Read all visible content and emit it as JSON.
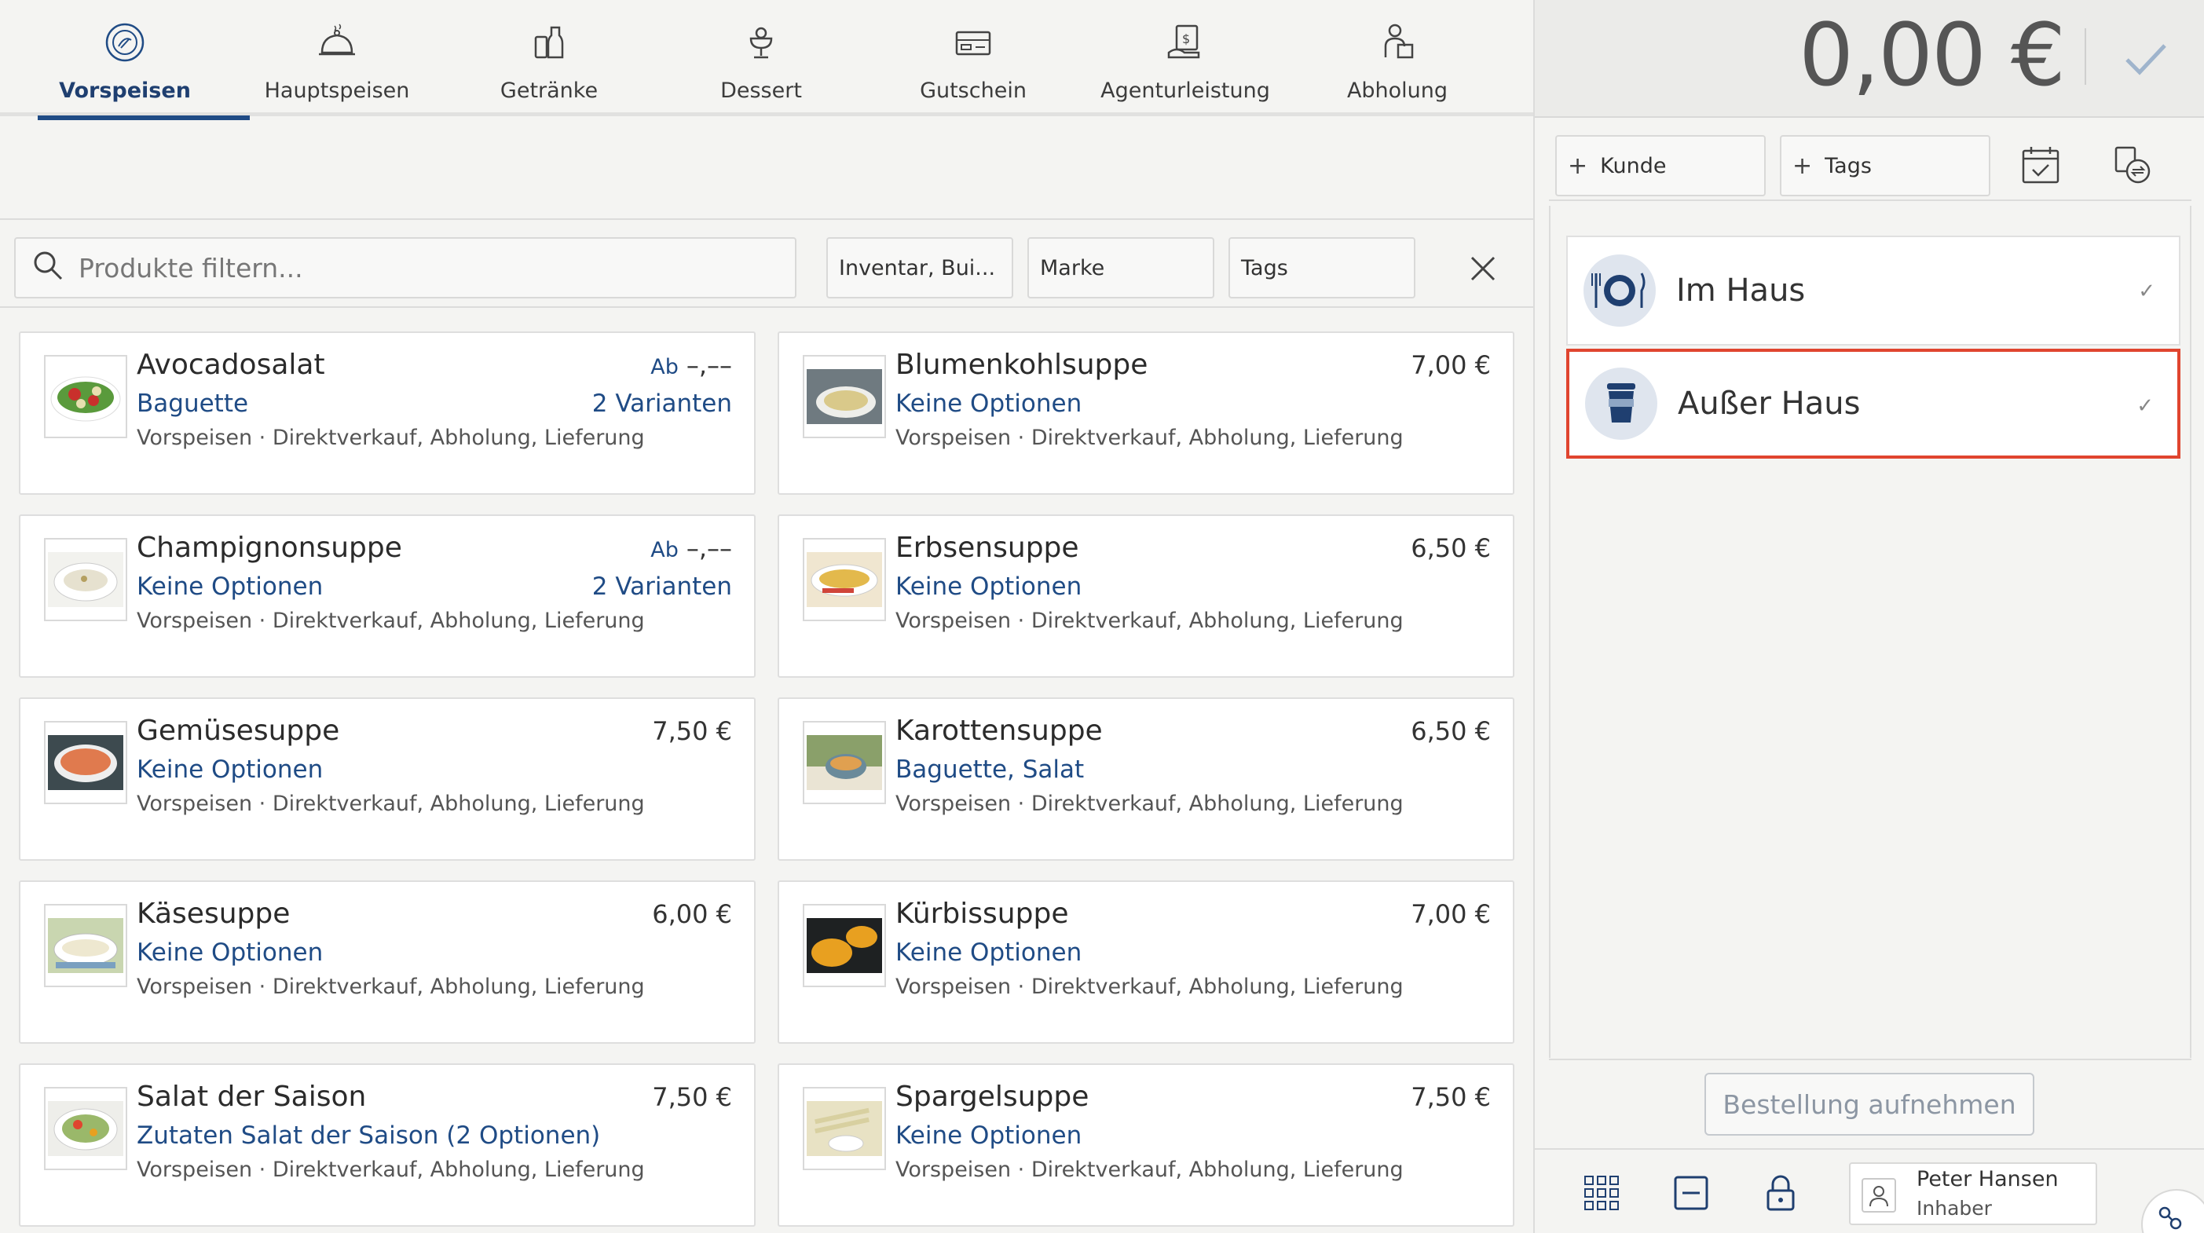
{
  "categories": [
    {
      "label": "Vorspeisen",
      "icon": "appetizer-icon",
      "active": true
    },
    {
      "label": "Hauptspeisen",
      "icon": "cloche-icon",
      "active": false
    },
    {
      "label": "Getränke",
      "icon": "drinks-icon",
      "active": false
    },
    {
      "label": "Dessert",
      "icon": "dessert-icon",
      "active": false
    },
    {
      "label": "Gutschein",
      "icon": "voucher-icon",
      "active": false
    },
    {
      "label": "Agenturleistung",
      "icon": "agency-service-icon",
      "active": false
    },
    {
      "label": "Abholung",
      "icon": "pickup-icon",
      "active": false
    }
  ],
  "filters": {
    "search_placeholder": "Produkte filtern...",
    "inventory": "Inventar, Bui...",
    "brand": "Marke",
    "tags": "Tags"
  },
  "products": [
    {
      "name": "Avocadosalat",
      "options": "Baguette",
      "meta": "Vorspeisen · Direktverkauf, Abholung, Lieferung",
      "price_prefix": "Ab",
      "price": "–,––",
      "variants": "2 Varianten",
      "thumb_color": "#5a9a3c"
    },
    {
      "name": "Blumenkohlsuppe",
      "options": "Keine Optionen",
      "meta": "Vorspeisen · Direktverkauf, Abholung, Lieferung",
      "price_prefix": "",
      "price": "7,00 €",
      "variants": "",
      "thumb_color": "#d9c98a"
    },
    {
      "name": "Champignonsuppe",
      "options": "Keine Optionen",
      "meta": "Vorspeisen · Direktverkauf, Abholung, Lieferung",
      "price_prefix": "Ab",
      "price": "–,––",
      "variants": "2 Varianten",
      "thumb_color": "#e6e1cf"
    },
    {
      "name": "Erbsensuppe",
      "options": "Keine Optionen",
      "meta": "Vorspeisen · Direktverkauf, Abholung, Lieferung",
      "price_prefix": "",
      "price": "6,50 €",
      "variants": "",
      "thumb_color": "#e3b94c"
    },
    {
      "name": "Gemüsesuppe",
      "options": "Keine Optionen",
      "meta": "Vorspeisen · Direktverkauf, Abholung, Lieferung",
      "price_prefix": "",
      "price": "7,50 €",
      "variants": "",
      "thumb_color": "#e07a4e"
    },
    {
      "name": "Karottensuppe",
      "options": "Baguette, Salat",
      "meta": "Vorspeisen · Direktverkauf, Abholung, Lieferung",
      "price_prefix": "",
      "price": "6,50 €",
      "variants": "",
      "thumb_color": "#8aa06a"
    },
    {
      "name": "Käsesuppe",
      "options": "Keine Optionen",
      "meta": "Vorspeisen · Direktverkauf, Abholung, Lieferung",
      "price_prefix": "",
      "price": "6,00 €",
      "variants": "",
      "thumb_color": "#c9d6b0"
    },
    {
      "name": "Kürbissuppe",
      "options": "Keine Optionen",
      "meta": "Vorspeisen · Direktverkauf, Abholung, Lieferung",
      "price_prefix": "",
      "price": "7,00 €",
      "variants": "",
      "thumb_color": "#e8a020"
    },
    {
      "name": "Salat der Saison",
      "options": "Zutaten Salat der Saison (2 Optionen)",
      "meta": "Vorspeisen · Direktverkauf, Abholung, Lieferung",
      "price_prefix": "",
      "price": "7,50 €",
      "variants": "",
      "thumb_color": "#9ab86a"
    },
    {
      "name": "Spargelsuppe",
      "options": "Keine Optionen",
      "meta": "Vorspeisen · Direktverkauf, Abholung, Lieferung",
      "price_prefix": "",
      "price": "7,50 €",
      "variants": "",
      "thumb_color": "#e8e2c4"
    }
  ],
  "order": {
    "total": "0,00 €",
    "customer_button": "Kunde",
    "tags_button": "Tags",
    "modes": [
      {
        "label": "Im Haus",
        "icon": "dine-in-plate-icon",
        "check": "✓"
      },
      {
        "label": "Außer Haus",
        "icon": "takeaway-cup-icon",
        "check": "✓",
        "highlighted": true
      }
    ],
    "submit_label": "Bestellung aufnehmen"
  },
  "user": {
    "name": "Peter Hansen",
    "role": "Inhaber"
  },
  "colors": {
    "accent": "#1f4b85",
    "highlight_border": "#e0452f",
    "background": "#f4f4f2"
  }
}
